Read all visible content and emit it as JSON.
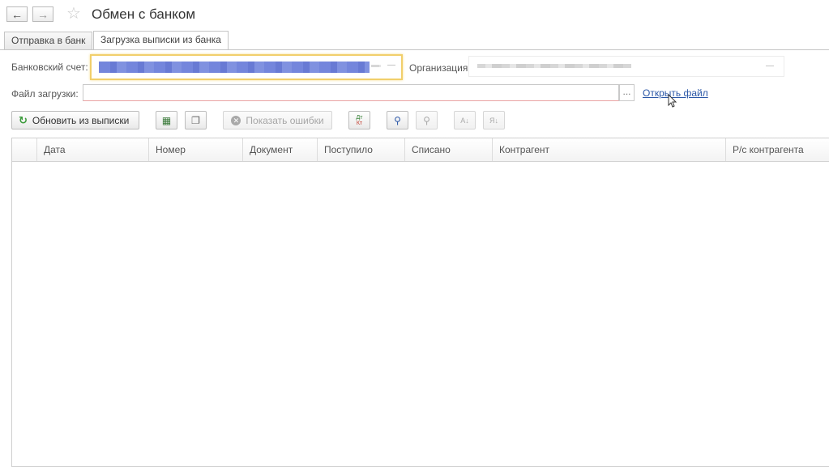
{
  "header": {
    "back_icon": "arrow-left-icon",
    "forward_icon": "arrow-right-icon",
    "favorite_icon": "star-icon",
    "title": "Обмен с банком"
  },
  "tabs": [
    {
      "label": "Отправка в банк",
      "active": false
    },
    {
      "label": "Загрузка выписки из банка",
      "active": true
    }
  ],
  "form": {
    "bank_account_label": "Банковский счет:",
    "organization_label": "Организация:",
    "file_label": "Файл загрузки:",
    "file_value": "",
    "file_select_button": "...",
    "open_file_link": "Открыть файл"
  },
  "toolbar": {
    "refresh_label": "Обновить из выписки",
    "show_errors_label": "Показать ошибки",
    "dtkt_label_top": "Дт",
    "dtkt_label_bottom": "Кт"
  },
  "table": {
    "columns": [
      "Дата",
      "Номер",
      "Документ",
      "Поступило",
      "Списано",
      "Контрагент",
      "Р/с контрагента"
    ],
    "rows": []
  },
  "colors": {
    "focus_border": "#f1cf6b",
    "link": "#2b57a7",
    "refresh_icon": "#3a9a3a",
    "errors_icon": "#9a9a9a"
  }
}
